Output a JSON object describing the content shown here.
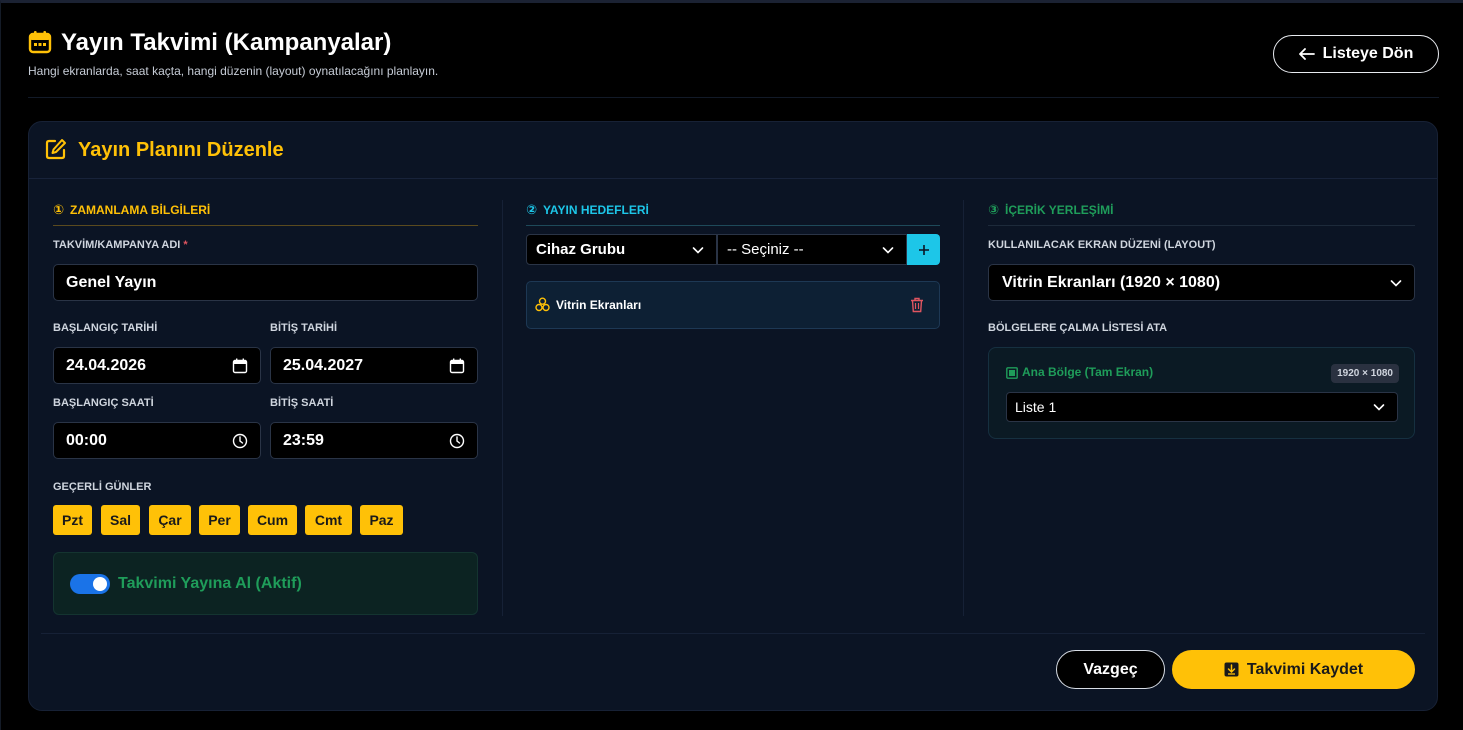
{
  "header": {
    "title": "Yayın Takvimi (Kampanyalar)",
    "subtitle": "Hangi ekranlarda, saat kaçta, hangi düzenin (layout) oynatılacağını planlayın.",
    "back_label": "Listeye Dön"
  },
  "card": {
    "title": "Yayın Planını Düzenle"
  },
  "timing": {
    "section_number": "①",
    "section_title": "ZAMANLAMA BİLGİLERİ",
    "name_label": "TAKVİM/KAMPANYA ADI",
    "required_mark": "*",
    "name_value": "Genel Yayın",
    "start_date_label": "BAŞLANGIÇ TARİHİ",
    "start_date": "24.04.2026",
    "end_date_label": "BİTİŞ TARİHİ",
    "end_date": "25.04.2027",
    "start_time_label": "BAŞLANGIÇ SAATİ",
    "start_time": "00:00",
    "end_time_label": "BİTİŞ SAATİ",
    "end_time": "23:59",
    "days_label": "GEÇERLİ GÜNLER",
    "days": [
      "Pzt",
      "Sal",
      "Çar",
      "Per",
      "Cum",
      "Cmt",
      "Paz"
    ],
    "toggle_label": "Takvimi Yayına Al (Aktif)",
    "toggle_on": true
  },
  "targets": {
    "section_number": "②",
    "section_title": "YAYIN HEDEFLERİ",
    "type_select": "Cihaz Grubu",
    "value_select": "-- Seçiniz --",
    "add_label": "+",
    "items": [
      {
        "label": "Vitrin Ekranları"
      }
    ]
  },
  "content": {
    "section_number": "③",
    "section_title": "İÇERİK YERLEŞİMİ",
    "layout_label": "KULLANILACAK EKRAN DÜZENİ (LAYOUT)",
    "layout_value": "Vitrin Ekranları (1920 × 1080)",
    "regions_label": "BÖLGELERE ÇALMA LİSTESİ ATA",
    "region": {
      "title": "Ana Bölge (Tam Ekran)",
      "badge": "1920 × 1080",
      "playlist": "Liste 1"
    }
  },
  "footer": {
    "cancel_label": "Vazgeç",
    "save_label": "Takvimi Kaydet"
  },
  "colors": {
    "accent": "#ffc107",
    "targets_accent": "#1dc6e8",
    "content_accent": "#1f9d5a",
    "card_bg": "#0b1424",
    "toggle_on": "#1a73e8",
    "danger": "#e05560"
  }
}
